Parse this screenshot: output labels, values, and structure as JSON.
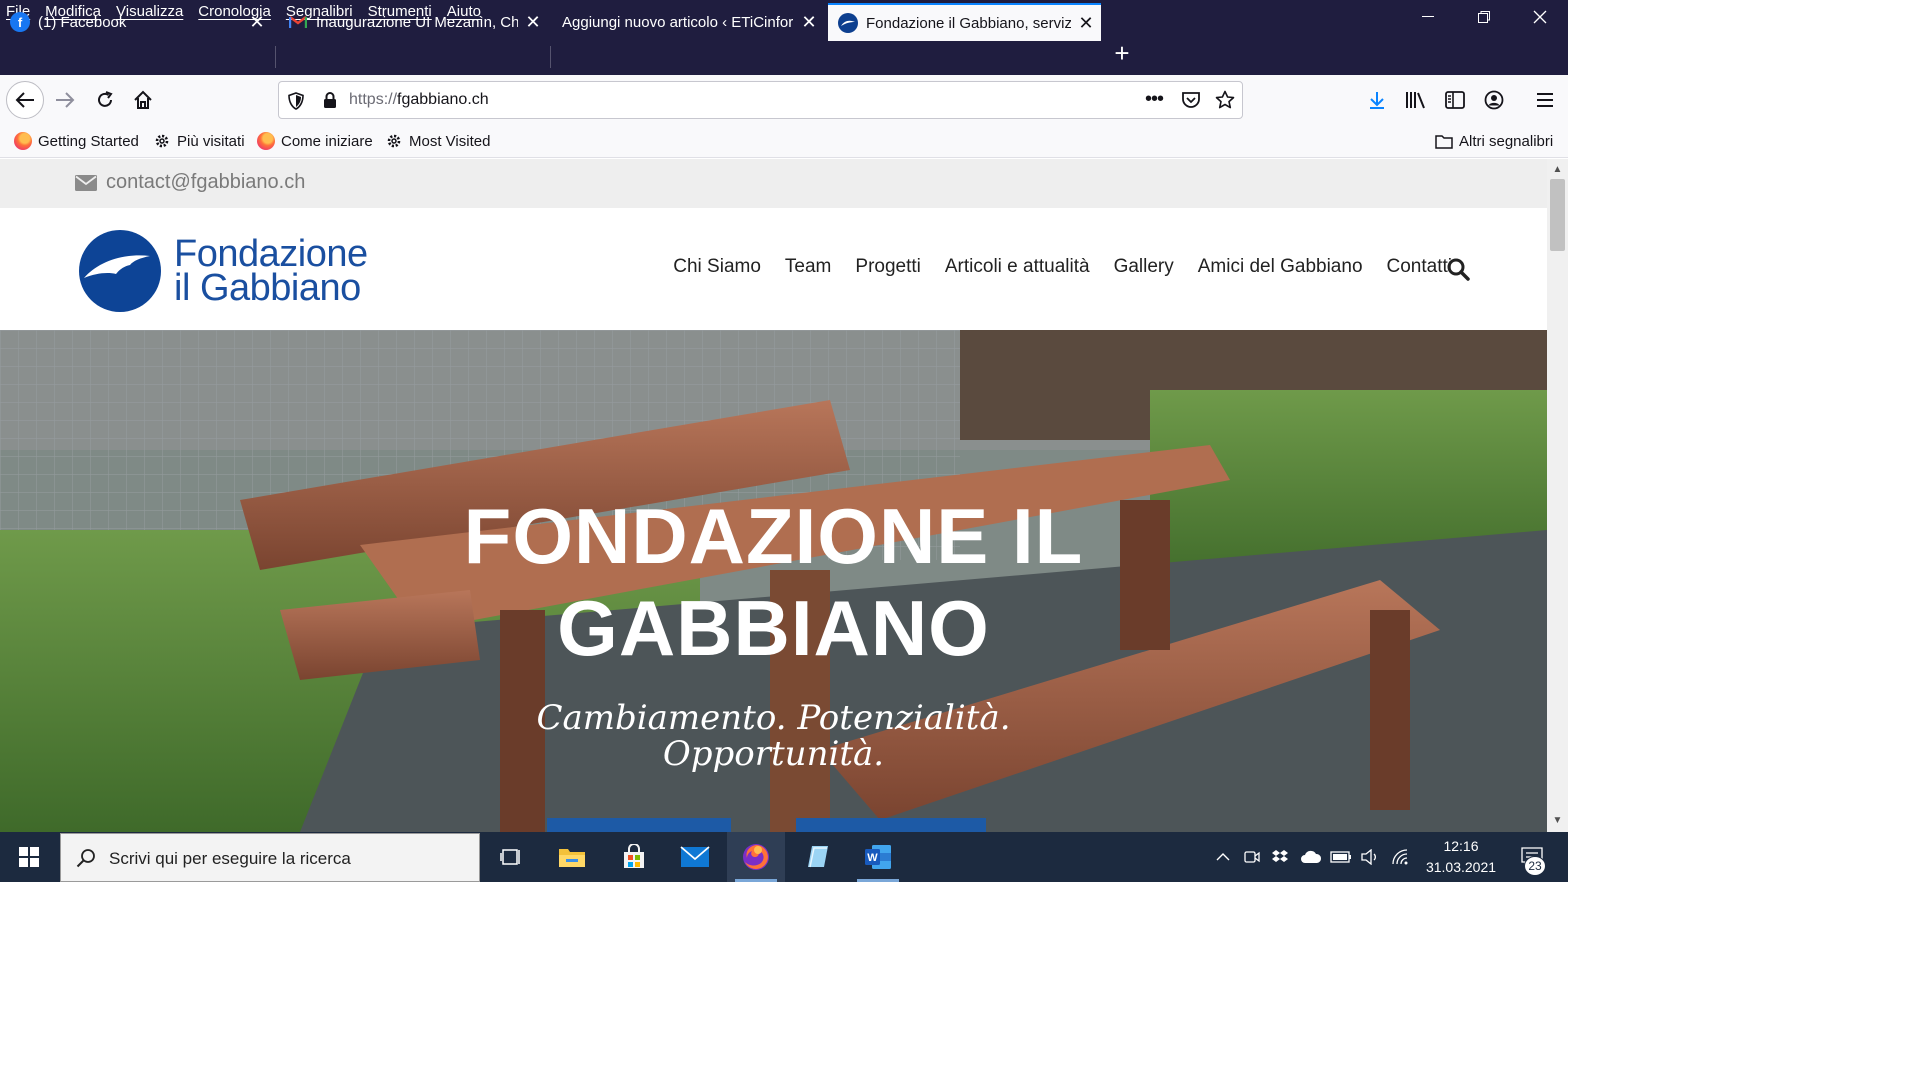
{
  "menubar": {
    "items": [
      "File",
      "Modifica",
      "Visualizza",
      "Cronologia",
      "Segnalibri",
      "Strumenti",
      "Aiuto"
    ]
  },
  "tabs": [
    {
      "title": "(1) Facebook",
      "icon": "facebook-icon"
    },
    {
      "title": "Inaugurazione UI Mezanìn, Chia",
      "icon": "gmail-icon"
    },
    {
      "title": "Aggiungi nuovo articolo ‹ ETiCinfor",
      "icon": "none"
    },
    {
      "title": "Fondazione il Gabbiano, servizi",
      "icon": "gabbiano-icon",
      "active": true
    }
  ],
  "urlbar": {
    "protocol": "https://",
    "host": "fgabbiano.ch"
  },
  "bookmarks": {
    "items": [
      "Getting Started",
      "Più visitati",
      "Come iniziare",
      "Most Visited"
    ],
    "other": "Altri segnalibri"
  },
  "site": {
    "contact_email": "contact@fgabbiano.ch",
    "logo_line1": "Fondazione",
    "logo_line2": "il Gabbiano",
    "nav": [
      "Chi Siamo",
      "Team",
      "Progetti",
      "Articoli e attualità",
      "Gallery",
      "Amici del Gabbiano",
      "Contatti"
    ],
    "hero_title_line1": "FONDAZIONE IL",
    "hero_title_line2": "GABBIANO",
    "tagline_line1": "Cambiamento. Potenzialità.",
    "tagline_line2": "Opportunità."
  },
  "taskbar": {
    "search_placeholder": "Scrivi qui per eseguire la ricerca",
    "time": "12:16",
    "date": "31.03.2021",
    "notifications": "23"
  },
  "colors": {
    "brand_blue": "#1a4fa0",
    "firefox_chrome": "#1f1d3f",
    "active_tab_accent": "#0a84ff"
  }
}
